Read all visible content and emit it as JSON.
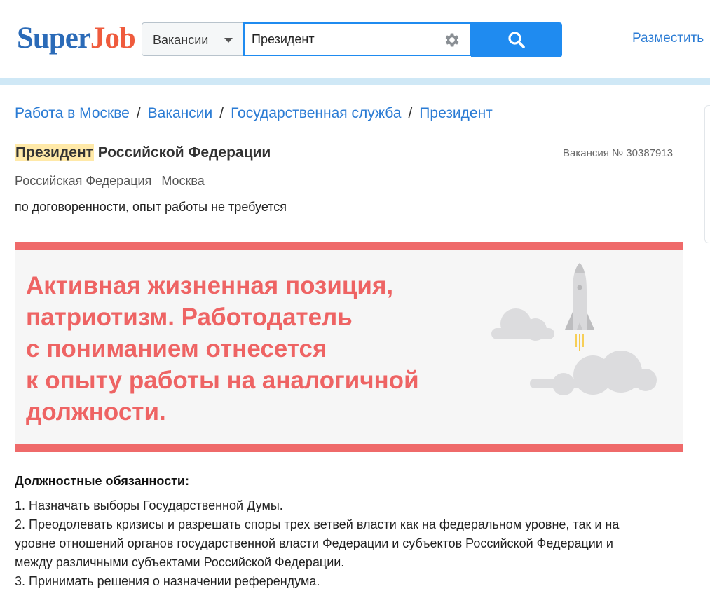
{
  "header": {
    "logo_part1": "Super",
    "logo_part2": "Job",
    "search_category": "Вакансии",
    "search_query": "Президент",
    "post_link": "Разместить"
  },
  "breadcrumbs": [
    "Работа в Москве",
    "Вакансии",
    "Государственная служба",
    "Президент"
  ],
  "vacancy": {
    "title_highlight": "Президент",
    "title_rest": " Российской Федерации",
    "number": "Вакансия № 30387913",
    "employer": "Российская Федерация",
    "city": "Москва",
    "terms": "по договоренности, опыт работы не требуется"
  },
  "banner": {
    "lines": [
      "Активная жизненная позиция,",
      "патриотизм. Работодатель",
      "с пониманием отнесется",
      "к опыту работы на аналогичной",
      "должности."
    ],
    "accent_color": "#ee6464"
  },
  "duties": {
    "heading": "Должностные обязанности:",
    "lines": [
      "1. Назначать выборы Государственной Думы.",
      "2. Преодолевать кризисы и разрешать споры трех ветвей власти как на федеральном уровне, так и на",
      "уровне отношений органов государственной власти Федерации и субъектов Российской Федерации и",
      "между различными субъектами Российской Федерации.",
      "3. Принимать решения о назначении референдума."
    ]
  },
  "colors": {
    "brand_blue": "#2b6bb8",
    "brand_orange": "#ef5b3d",
    "link": "#2a7bd4",
    "search_button": "#1f8bf0"
  }
}
